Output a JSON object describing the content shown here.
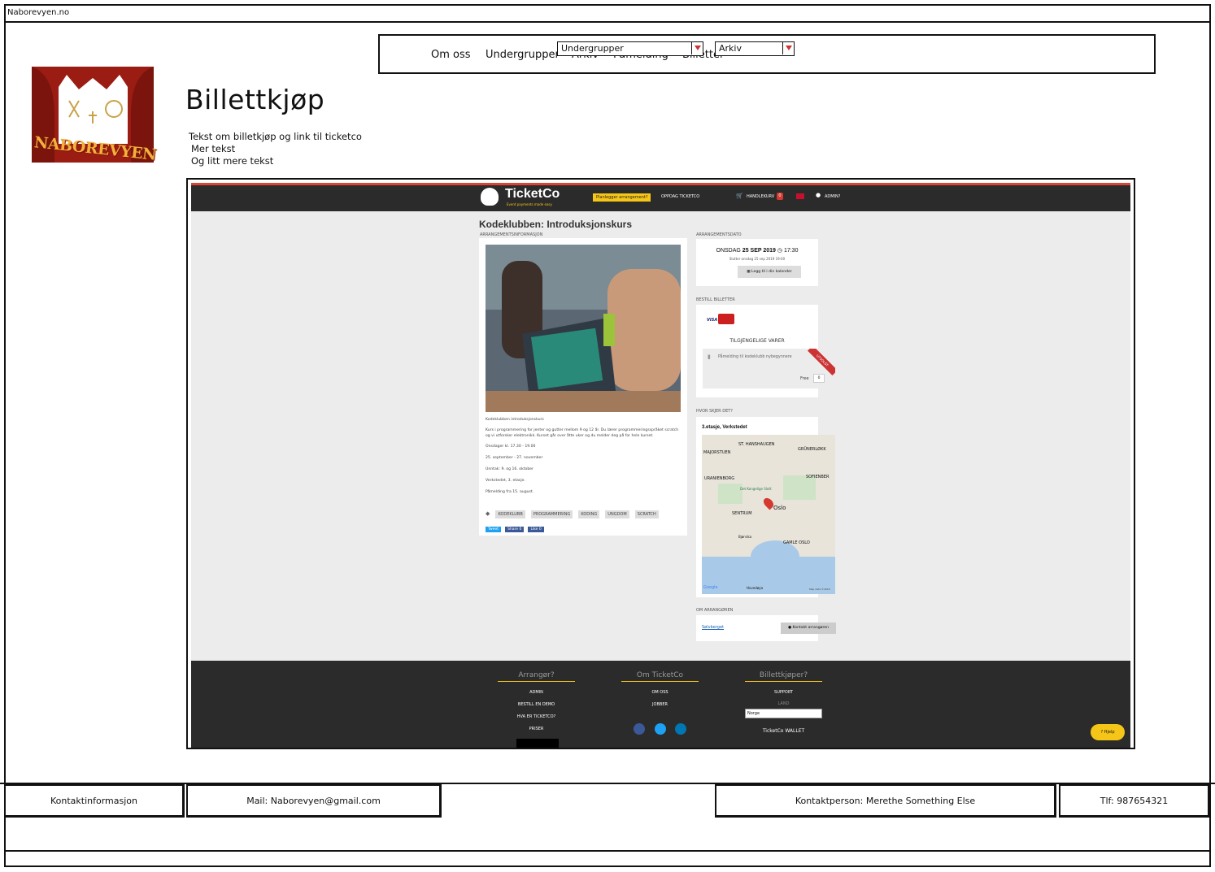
{
  "window": {
    "title": "Naborevyen.no"
  },
  "nav": {
    "items": [
      "Om oss",
      "Undergrupper",
      "Arkiv",
      "Påmelding",
      "Billetter"
    ],
    "dropdown_undergrupper": "Undergrupper",
    "dropdown_arkiv": "Arkiv"
  },
  "logo": {
    "text": "NABOREVYEN"
  },
  "page": {
    "title": "Billettkjøp",
    "lines": [
      "Tekst om billetkjøp og link til ticketco",
      "Mer tekst",
      "Og litt mere tekst"
    ]
  },
  "ticketco": {
    "brand": "TicketCo",
    "tagline": "Event payments made easy",
    "header_button": "Planlegger arrangement?",
    "header_links": [
      "OPPDAG TICKETCO",
      "HANDLEKURV",
      "ADMIN?"
    ],
    "cart_count": "0",
    "event_title": "Kodeklubben: Introduksjonskurs",
    "section_info": "ARRANGEMENTSINFORMASJON",
    "section_date": "ARRANGEMENTSDATO",
    "date_day": "ONSDAG",
    "date_main": "25 SEP 2019",
    "date_time": "17:30",
    "date_end": "Slutter onsdag 25 sep 2019 19:00",
    "calendar_button": "Legg til i din kalender",
    "section_order": "BESTILL BILLETTER",
    "card_visa": "VISA",
    "available": "TILGJENGELIGE VARER",
    "ticket_name": "Påmelding til kodeklubb nybegynnere",
    "ticket_ribbon": "UTSOLGT",
    "ticket_price": "Free",
    "ticket_qty": "0",
    "section_where": "HVOR SKJER DET?",
    "venue": "3.etasje, Verkstedet",
    "map_labels": [
      "ST. HANSHAUGEN",
      "GRÜNERLØKK",
      "MAJORSTUEN",
      "URANIENBORG",
      "SOFIENBER",
      "SENTRUM",
      "Oslo",
      "GAMLE OSLO",
      "Det Kongelige Slott",
      "Bjørvika",
      "Hovedøya"
    ],
    "map_footer": "Google",
    "map_credit": "Map data ©2019",
    "section_org": "OM ARRANGØREN",
    "org_link": "Sølvberget",
    "org_button": "Kontakt arrangøren",
    "desc_lines": [
      "Kodeklubben introduksjonskurs",
      "Kurs i programmering for jenter og gutter mellom 9 og 12 år. Du lærer programmeringsspråket scratch og vi utforsker elektronikk. Kurset går over åtte uker og du melder deg på for hele kurset.",
      "Onsdager kl. 17.30 - 19.00",
      "25. september - 27. november",
      "Unntak: 9. og 16. oktober",
      "Verkstedet, 3. etasje.",
      "Påmelding fra 15. august."
    ],
    "tags": [
      "KODEKLUBB",
      "PROGRAMMERING",
      "KODING",
      "UNGDOM",
      "SCRATCH"
    ],
    "share": [
      "Tweet",
      "Share 0",
      "Like 0"
    ],
    "footer_cols": [
      {
        "title": "Arrangør?",
        "links": [
          "ADMIN",
          "BESTILL EN DEMO",
          "HVA ER TICKETCO?",
          "PRISER"
        ]
      },
      {
        "title": "Om TicketCo",
        "links": [
          "OM OSS",
          "JOBBER"
        ]
      },
      {
        "title": "Billettkjøper?",
        "links": [
          "SUPPORT",
          "LAND"
        ]
      }
    ],
    "country_select": "Norge",
    "wallet": "TicketCo WALLET",
    "help_button": "Hjelp"
  },
  "footer": {
    "contact_label": "Kontaktinformasjon",
    "mail": "Mail: Naborevyen@gmail.com",
    "person": "Kontaktperson: Merethe Something Else",
    "phone": "Tlf: 987654321"
  },
  "colors": {
    "logo_red": "#9b1c12",
    "ticketco_dark": "#2b2b2b",
    "ticketco_yellow": "#f5c518",
    "accent_red": "#d43a2f"
  }
}
